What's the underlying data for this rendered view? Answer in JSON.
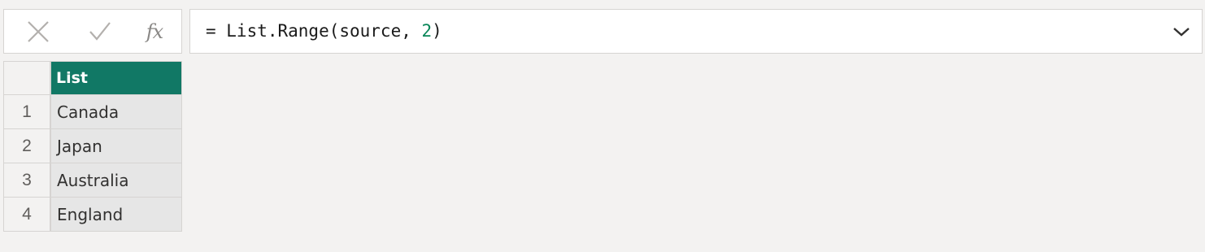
{
  "formula_bar": {
    "cancel_icon": "close-icon",
    "commit_icon": "check-icon",
    "fx_label": "fx",
    "formula_prefix": "= List.Range(source, ",
    "formula_number": "2",
    "formula_suffix": ")",
    "expand_icon": "chevron-down-icon"
  },
  "grid": {
    "column_header": "List",
    "rows": [
      {
        "index": "1",
        "value": "Canada"
      },
      {
        "index": "2",
        "value": "Japan"
      },
      {
        "index": "3",
        "value": "Australia"
      },
      {
        "index": "4",
        "value": "England"
      }
    ]
  },
  "colors": {
    "header_bg": "#117865",
    "background": "#f3f2f1",
    "cell_bg": "#e6e6e6",
    "number_literal": "#098658"
  }
}
